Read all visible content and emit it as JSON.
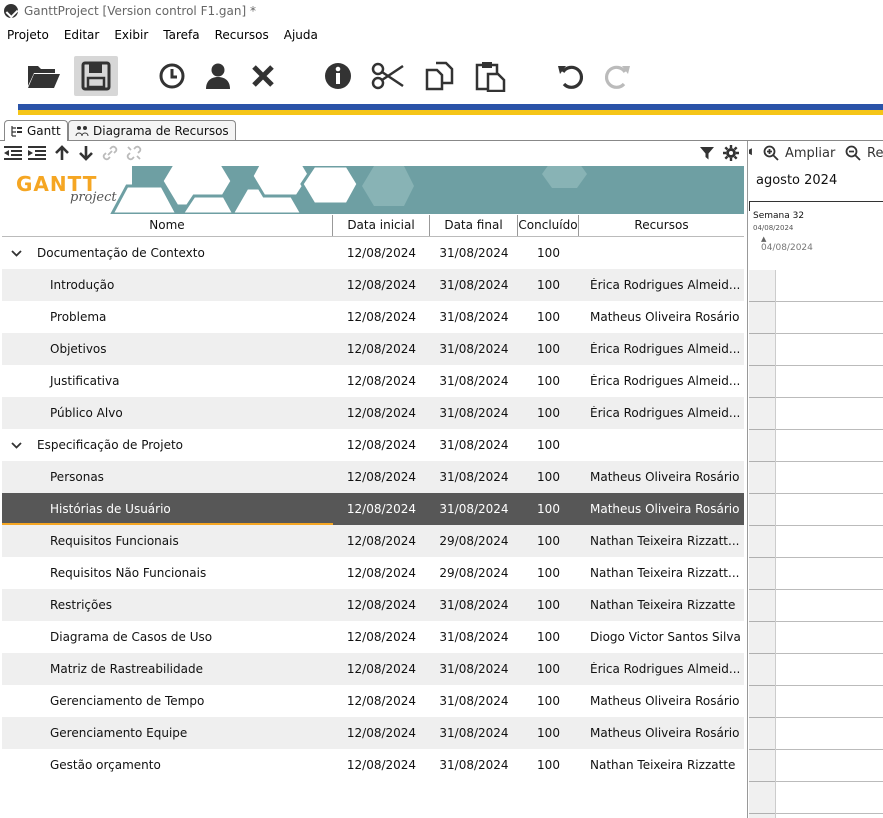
{
  "window": {
    "title": "GanttProject [Version control F1.gan] *"
  },
  "menu": [
    "Projeto",
    "Editar",
    "Exibir",
    "Tarefa",
    "Recursos",
    "Ajuda"
  ],
  "toolbar": {
    "icons": [
      "open-folder-icon",
      "save-icon",
      "clock-icon",
      "person-icon",
      "delete-x-icon",
      "info-icon",
      "scissors-icon",
      "copy-icon",
      "paste-icon",
      "undo-icon",
      "redo-icon"
    ]
  },
  "tabs": {
    "gantt": "Gantt",
    "resources": "Diagrama de Recursos"
  },
  "banner": {
    "logo_main": "GANTT",
    "logo_sub": "project"
  },
  "columns": {
    "name": "Nome",
    "start": "Data inicial",
    "end": "Data final",
    "done": "Concluído",
    "resources": "Recursos"
  },
  "tasks": [
    {
      "name": "Documentação de Contexto",
      "start": "12/08/2024",
      "end": "31/08/2024",
      "done": "100",
      "resources": "",
      "group": true
    },
    {
      "name": "Introdução",
      "start": "12/08/2024",
      "end": "31/08/2024",
      "done": "100",
      "resources": "Érica Rodrigues Almeid..."
    },
    {
      "name": "Problema",
      "start": "12/08/2024",
      "end": "31/08/2024",
      "done": "100",
      "resources": "Matheus Oliveira Rosário"
    },
    {
      "name": "Objetivos",
      "start": "12/08/2024",
      "end": "31/08/2024",
      "done": "100",
      "resources": "Érica Rodrigues Almeid..."
    },
    {
      "name": "Justificativa",
      "start": "12/08/2024",
      "end": "31/08/2024",
      "done": "100",
      "resources": "Érica Rodrigues Almeid..."
    },
    {
      "name": "Público Alvo",
      "start": "12/08/2024",
      "end": "31/08/2024",
      "done": "100",
      "resources": "Érica Rodrigues Almeid..."
    },
    {
      "name": "Especificação de Projeto",
      "start": "12/08/2024",
      "end": "31/08/2024",
      "done": "100",
      "resources": "",
      "group": true
    },
    {
      "name": "Personas",
      "start": "12/08/2024",
      "end": "31/08/2024",
      "done": "100",
      "resources": "Matheus Oliveira Rosário"
    },
    {
      "name": "Histórias de Usuário",
      "start": "12/08/2024",
      "end": "31/08/2024",
      "done": "100",
      "resources": "Matheus Oliveira Rosário",
      "selected": true
    },
    {
      "name": "Requisitos Funcionais",
      "start": "12/08/2024",
      "end": "29/08/2024",
      "done": "100",
      "resources": "Nathan Teixeira Rizzatt..."
    },
    {
      "name": "Requisitos Não Funcionais",
      "start": "12/08/2024",
      "end": "29/08/2024",
      "done": "100",
      "resources": "Nathan Teixeira Rizzatt..."
    },
    {
      "name": "Restrições",
      "start": "12/08/2024",
      "end": "31/08/2024",
      "done": "100",
      "resources": "Nathan Teixeira Rizzatte"
    },
    {
      "name": "Diagrama de Casos de Uso",
      "start": "12/08/2024",
      "end": "31/08/2024",
      "done": "100",
      "resources": "Diogo Victor Santos Silva"
    },
    {
      "name": "Matriz de Rastreabilidade",
      "start": "12/08/2024",
      "end": "31/08/2024",
      "done": "100",
      "resources": "Érica Rodrigues Almeid..."
    },
    {
      "name": "Gerenciamento de Tempo",
      "start": "12/08/2024",
      "end": "31/08/2024",
      "done": "100",
      "resources": "Matheus Oliveira Rosário"
    },
    {
      "name": "Gerenciamento Equipe",
      "start": "12/08/2024",
      "end": "31/08/2024",
      "done": "100",
      "resources": "Matheus Oliveira Rosário"
    },
    {
      "name": "Gestão orçamento",
      "start": "12/08/2024",
      "end": "31/08/2024",
      "done": "100",
      "resources": "Nathan Teixeira Rizzatte"
    }
  ],
  "chart": {
    "zoom_in": "Ampliar",
    "zoom_out": "Re",
    "month": "agosto 2024",
    "week": "Semana 32",
    "week_date": "04/08/2024",
    "day_date": "04/08/2024"
  },
  "colors": {
    "stripe_blue": "#2a53a8",
    "stripe_yellow": "#f5c518",
    "banner": "#6e9fa3",
    "selected_row": "#575757",
    "selection_underline": "#f5a623"
  }
}
